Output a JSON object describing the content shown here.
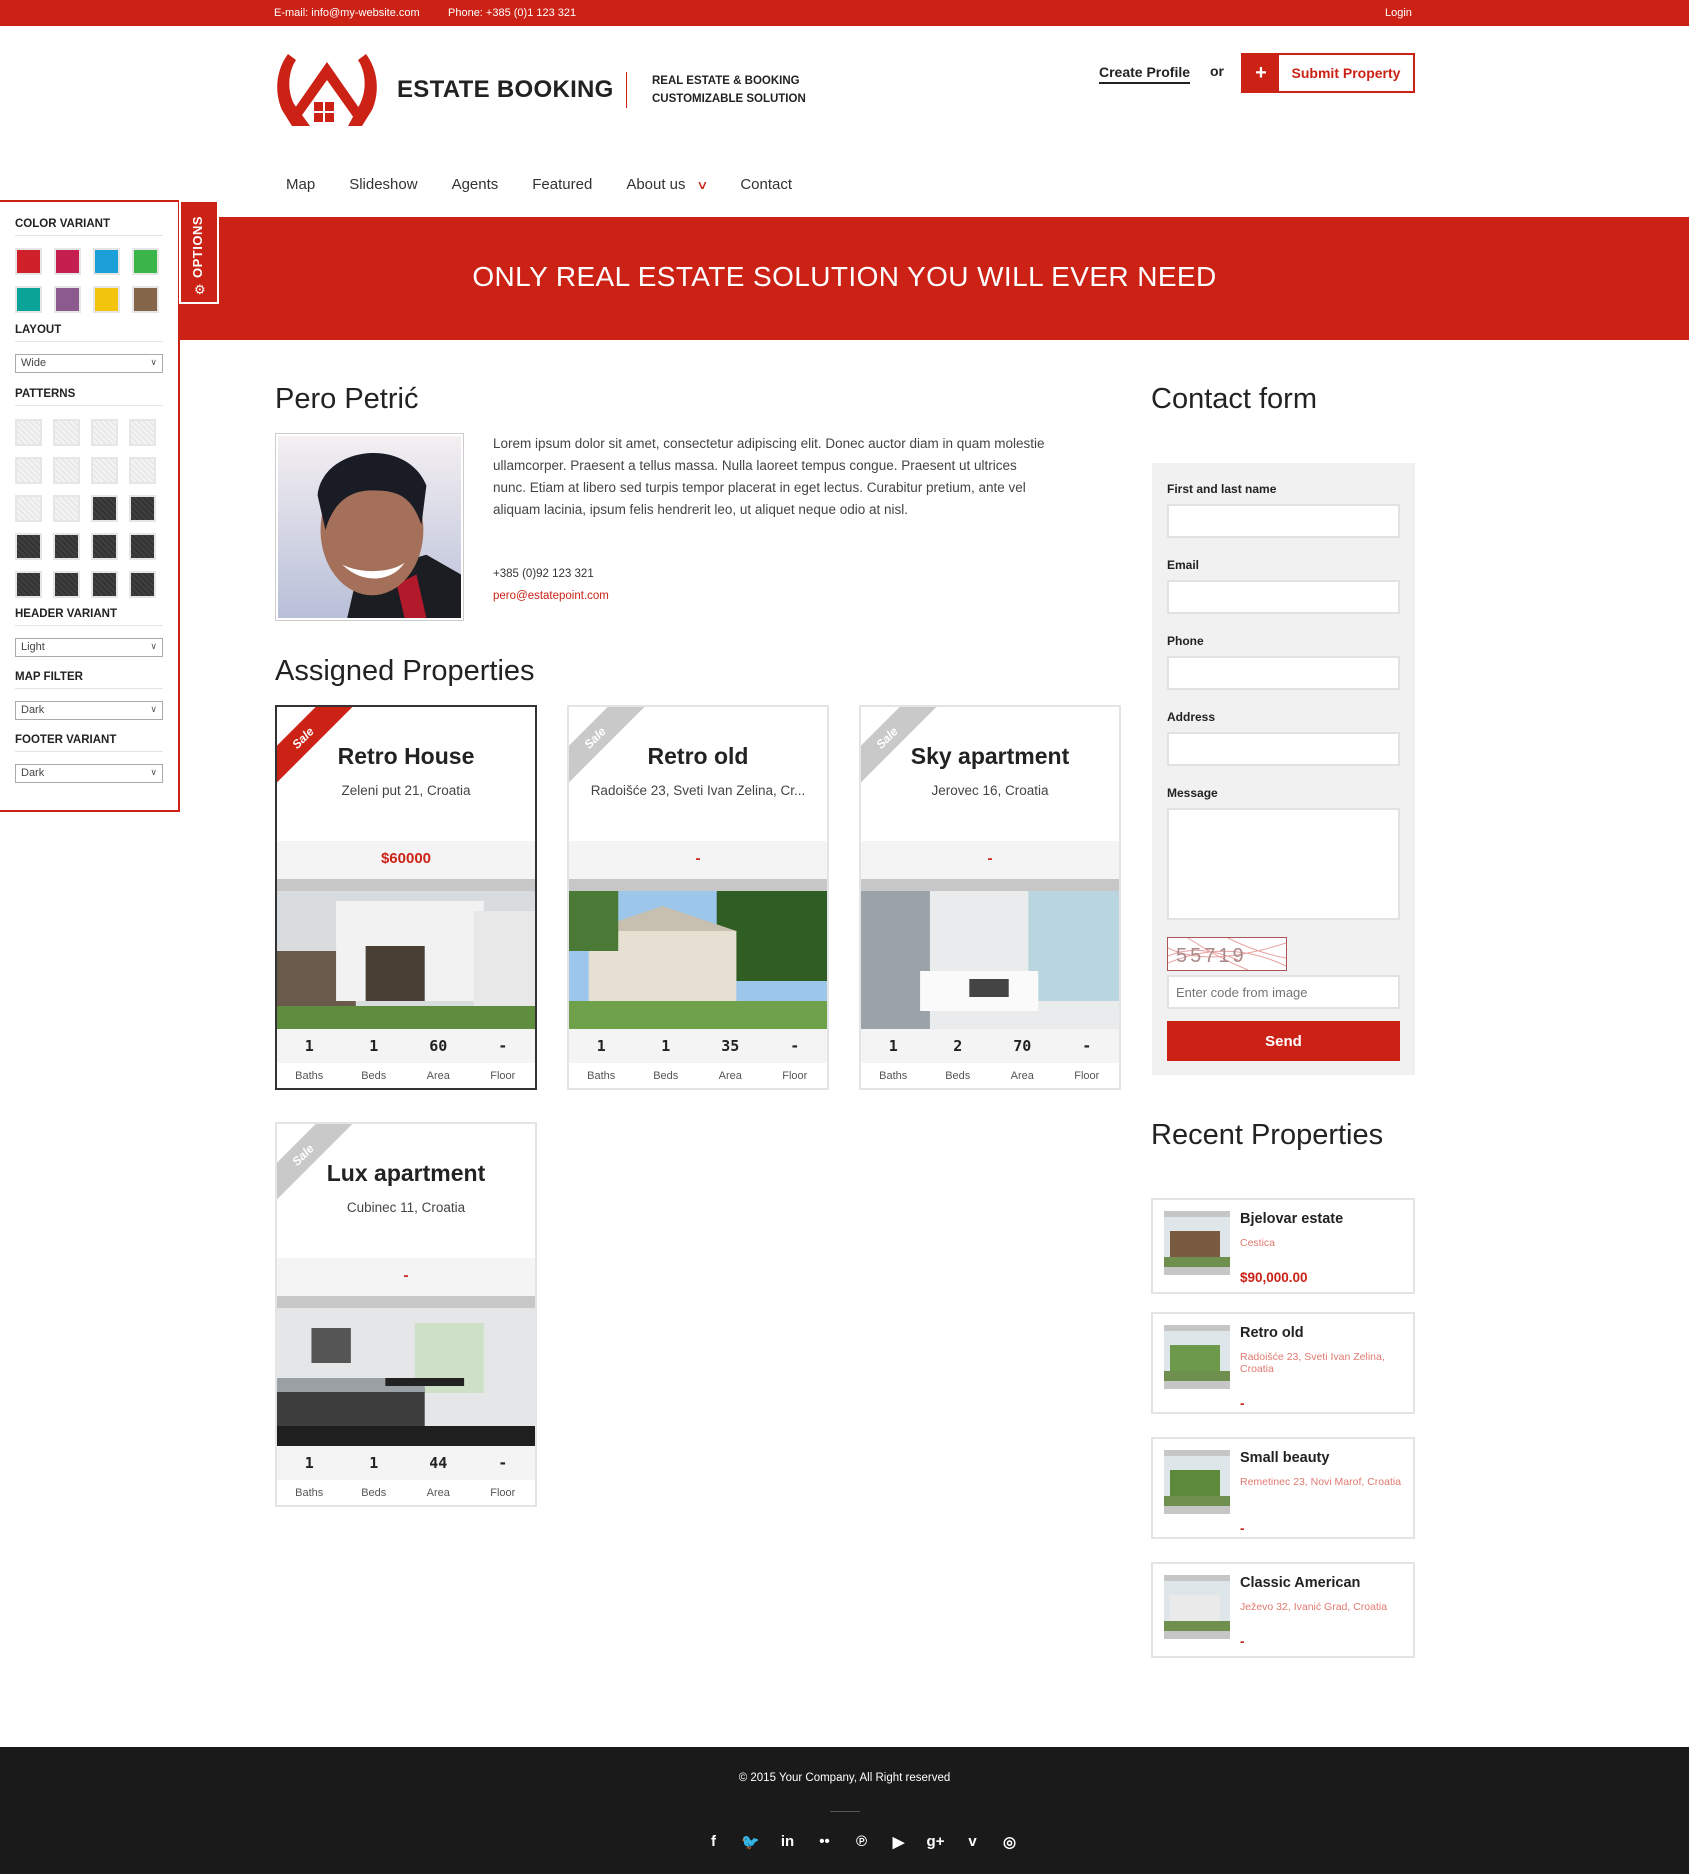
{
  "topbar": {
    "email": "E-mail: info@my-website.com",
    "phone": "Phone: +385 (0)1 123 321",
    "login": "Login"
  },
  "header": {
    "brand": "ESTATE BOOKING",
    "tagline_line1": "REAL ESTATE & BOOKING",
    "tagline_line2": "CUSTOMIZABLE SOLUTION",
    "create_profile": "Create Profile",
    "or": "or",
    "submit_plus": "+",
    "submit_property": "Submit Property",
    "accent_color": "#cc2216"
  },
  "nav": {
    "items": [
      {
        "label": "Map"
      },
      {
        "label": "Slideshow"
      },
      {
        "label": "Agents"
      },
      {
        "label": "Featured"
      },
      {
        "label": "About us",
        "has_dropdown": true
      },
      {
        "label": "Contact"
      }
    ],
    "dropdown_icon": "chevron-down-icon"
  },
  "hero": {
    "title": "ONLY REAL ESTATE SOLUTION YOU WILL EVER NEED"
  },
  "options": {
    "tab_label": "OPTIONS",
    "tab_icon": "gear-icon",
    "color_variant_label": "COLOR VARIANT",
    "colors": [
      "#d0202a",
      "#c41f4e",
      "#1b9fd9",
      "#3ab54a",
      "#0ba397",
      "#8c5a8e",
      "#f2c40d",
      "#85654a"
    ],
    "layout_label": "LAYOUT",
    "layout_value": "Wide",
    "patterns_label": "PATTERNS",
    "patterns": [
      "light-1",
      "light-2",
      "light-3",
      "light-4",
      "light-5",
      "light-6",
      "light-7",
      "light-8",
      "light-9",
      "light-10",
      "dark-1",
      "dark-2",
      "dark-3",
      "dark-4",
      "dark-5",
      "dark-6",
      "dark-7",
      "dark-8",
      "dark-9",
      "dark-10"
    ],
    "header_variant_label": "HEADER VARIANT",
    "header_variant_value": "Light",
    "map_filter_label": "MAP FILTER",
    "map_filter_value": "Dark",
    "footer_variant_label": "FOOTER VARIANT",
    "footer_variant_value": "Dark"
  },
  "agent": {
    "name": "Pero Petrić",
    "bio": "Lorem ipsum dolor sit amet, consectetur adipiscing elit. Donec auctor diam in quam molestie ullamcorper. Praesent a tellus massa. Nulla laoreet tempus congue. Praesent ut ultrices nunc. Etiam at libero sed turpis tempor placerat in eget lectus. Curabitur pretium, ante vel aliquam lacinia, ipsum felis hendrerit leo, ut aliquet neque odio at nisl.",
    "phone": "+385 (0)92 123 321",
    "email": "pero@estatepoint.com"
  },
  "assigned": {
    "heading": "Assigned Properties",
    "stat_labels": [
      "Baths",
      "Beds",
      "Area",
      "Floor"
    ],
    "properties": [
      {
        "badge": "Sale",
        "title": "Retro House",
        "address": "Zeleni put 21, Croatia",
        "price": "$60000",
        "baths": "1",
        "beds": "1",
        "area": "60",
        "floor": "-",
        "active": true
      },
      {
        "badge": "Sale",
        "title": "Retro old",
        "address": "Radoišće 23, Sveti Ivan Zelina, Cr...",
        "price": "-",
        "baths": "1",
        "beds": "1",
        "area": "35",
        "floor": "-"
      },
      {
        "badge": "Sale",
        "title": "Sky apartment",
        "address": "Jerovec 16, Croatia",
        "price": "-",
        "baths": "1",
        "beds": "2",
        "area": "70",
        "floor": "-"
      },
      {
        "badge": "Sale",
        "title": "Lux apartment",
        "address": "Cubinec 11, Croatia",
        "price": "-",
        "baths": "1",
        "beds": "1",
        "area": "44",
        "floor": "-"
      }
    ]
  },
  "contact": {
    "heading": "Contact form",
    "name_label": "First and last name",
    "email_label": "Email",
    "phone_label": "Phone",
    "address_label": "Address",
    "message_label": "Message",
    "captcha_text": "55719",
    "captcha_placeholder": "Enter code from image",
    "send_label": "Send"
  },
  "recent": {
    "heading": "Recent Properties",
    "items": [
      {
        "title": "Bjelovar estate",
        "address": "Cestica",
        "price": "$90,000.00"
      },
      {
        "title": "Retro old",
        "address": "Radoišće 23, Sveti Ivan Zelina, Croatia",
        "price": "-"
      },
      {
        "title": "Small beauty",
        "address": "Remetinec 23, Novi Marof, Croatia",
        "price": "-"
      },
      {
        "title": "Classic American",
        "address": "Ježevo 32, Ivanić Grad, Croatia",
        "price": "-"
      }
    ]
  },
  "footer": {
    "copyright": "© 2015 Your Company, All Right reserved",
    "social": [
      {
        "name": "facebook-icon",
        "glyph": "f"
      },
      {
        "name": "twitter-icon",
        "glyph": "🐦"
      },
      {
        "name": "linkedin-icon",
        "glyph": "in"
      },
      {
        "name": "flickr-icon",
        "glyph": "••"
      },
      {
        "name": "pinterest-icon",
        "glyph": "℗"
      },
      {
        "name": "youtube-icon",
        "glyph": "▶"
      },
      {
        "name": "google-plus-icon",
        "glyph": "g+"
      },
      {
        "name": "vimeo-icon",
        "glyph": "v"
      },
      {
        "name": "dribbble-icon",
        "glyph": "◎"
      }
    ]
  }
}
